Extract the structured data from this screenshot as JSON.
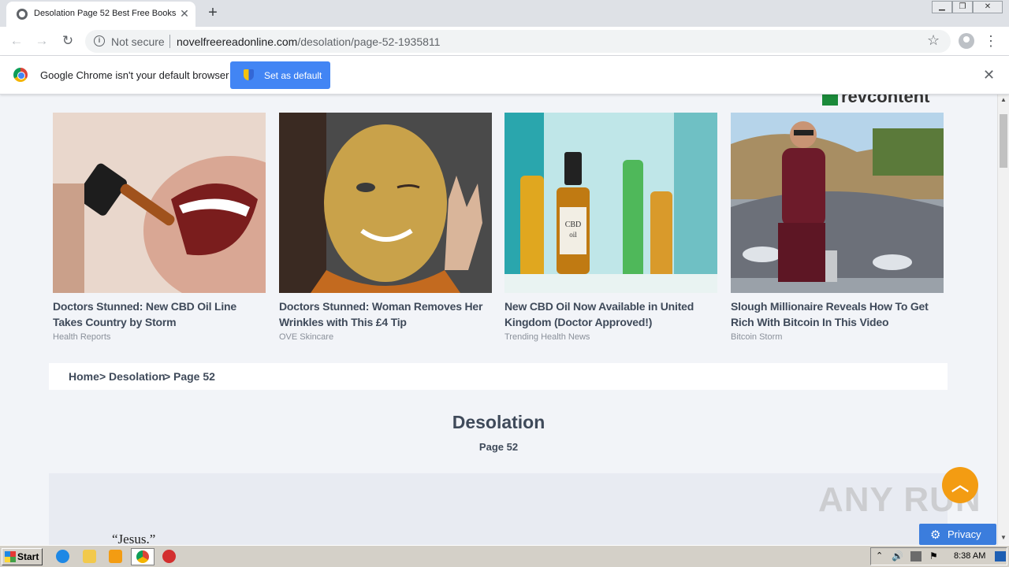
{
  "browser": {
    "tab_title": "Desolation Page 52 Best Free Books",
    "tab_close": "✕",
    "new_tab": "+",
    "security_label": "Not secure",
    "url_host": "novelfreereadonline.com",
    "url_path": "/desolation/page-52-1935811"
  },
  "infobar": {
    "message": "Google Chrome isn't your default browser",
    "button_label": "Set as default"
  },
  "ads": {
    "brand": "revcontent",
    "cards": [
      {
        "headline": "Doctors Stunned: New CBD Oil Line Takes Country by Storm",
        "source": "Health Reports"
      },
      {
        "headline": "Doctors Stunned: Woman Removes Her Wrinkles with This £4 Tip",
        "source": "OVE Skincare"
      },
      {
        "headline": "New CBD Oil Now Available in United Kingdom (Doctor Approved!)",
        "source": "Trending Health News"
      },
      {
        "headline": "Slough Millionaire Reveals How To Get Rich With Bitcoin In This Video",
        "source": "Bitcoin Storm"
      }
    ]
  },
  "breadcrumb": {
    "home": "Home",
    "book": "Desolation",
    "page": "Page 52",
    "sep": ">"
  },
  "content": {
    "book_title": "Desolation",
    "page_label": "Page 52",
    "first_line": "“Jesus.”"
  },
  "overlay": {
    "privacy_label": "Privacy",
    "watermark": "ANY RUN"
  },
  "taskbar": {
    "start_label": "Start",
    "clock": "8:38 AM"
  }
}
